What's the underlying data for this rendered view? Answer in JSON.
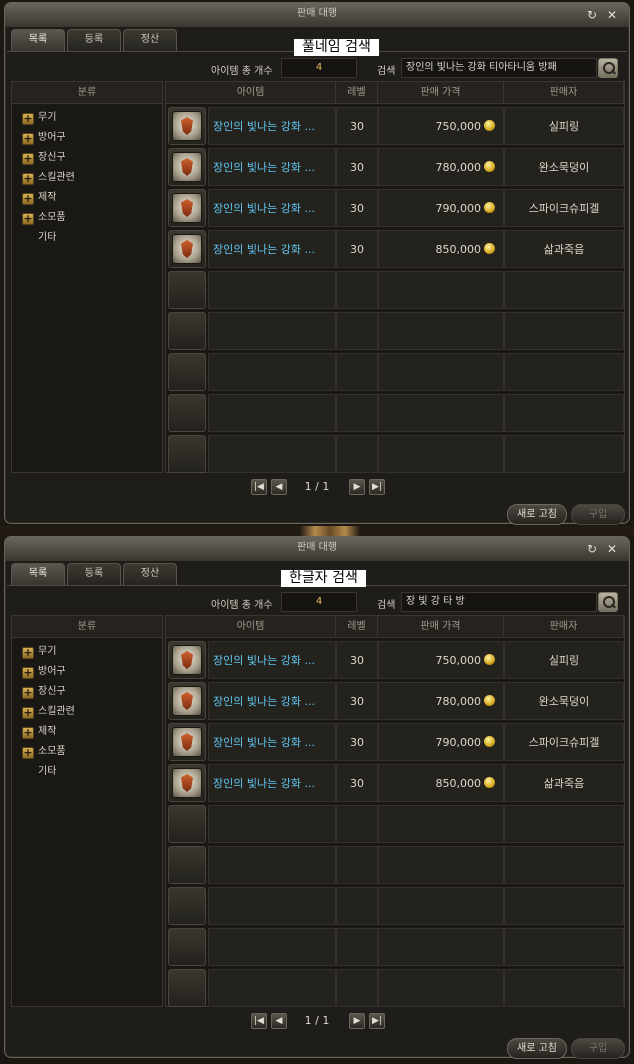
{
  "windows": [
    {
      "title": "판매 대행",
      "overlay_label": "풀네임 검색",
      "tabs": [
        "목록",
        "등록",
        "정산"
      ],
      "count_label": "아이템 총 개수",
      "count_value": "4",
      "search_label": "검색",
      "search_value": "장인의 빛나는 강화 티아타니움 방패",
      "category_header": "분류",
      "categories": [
        "무기",
        "방어구",
        "장신구",
        "스킬관련",
        "제작",
        "소모품",
        "기타"
      ],
      "columns": [
        "아이템",
        "레벨",
        "판매 가격",
        "판매자"
      ],
      "rows": [
        {
          "name": "장인의 빛나는 강화 ...",
          "level": "30",
          "price": "750,000",
          "seller": "실피링"
        },
        {
          "name": "장인의 빛나는 강화 ...",
          "level": "30",
          "price": "780,000",
          "seller": "완소묵덩이"
        },
        {
          "name": "장인의 빛나는 강화 ...",
          "level": "30",
          "price": "790,000",
          "seller": "스파이크슈피겔"
        },
        {
          "name": "장인의 빛나는 강화 ...",
          "level": "30",
          "price": "850,000",
          "seller": "삶과죽음"
        }
      ],
      "page": "1 / 1",
      "refresh_label": "새로 고침",
      "buy_label": "구입"
    },
    {
      "title": "판매 대행",
      "overlay_label": "한글자 검색",
      "tabs": [
        "목록",
        "등록",
        "정산"
      ],
      "count_label": "아이템 총 개수",
      "count_value": "4",
      "search_label": "검색",
      "search_value": "장 빛 강 타 방",
      "category_header": "분류",
      "categories": [
        "무기",
        "방어구",
        "장신구",
        "스킬관련",
        "제작",
        "소모품",
        "기타"
      ],
      "columns": [
        "아이템",
        "레벨",
        "판매 가격",
        "판매자"
      ],
      "rows": [
        {
          "name": "장인의 빛나는 강화 ...",
          "level": "30",
          "price": "750,000",
          "seller": "실피링"
        },
        {
          "name": "장인의 빛나는 강화 ...",
          "level": "30",
          "price": "780,000",
          "seller": "완소묵덩이"
        },
        {
          "name": "장인의 빛나는 강화 ...",
          "level": "30",
          "price": "790,000",
          "seller": "스파이크슈피겔"
        },
        {
          "name": "장인의 빛나는 강화 ...",
          "level": "30",
          "price": "850,000",
          "seller": "삶과죽음"
        }
      ],
      "page": "1 / 1",
      "refresh_label": "새로 고침",
      "buy_label": "구입"
    }
  ]
}
